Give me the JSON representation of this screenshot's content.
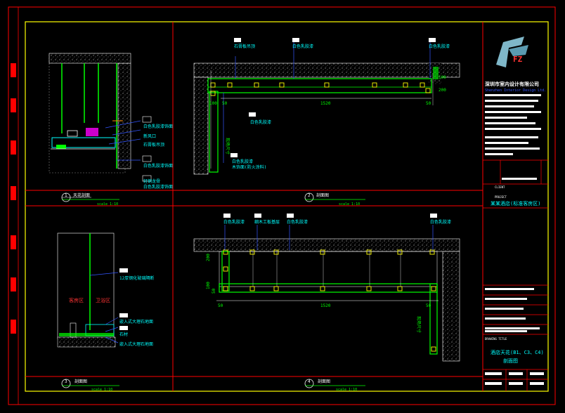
{
  "drawing": {
    "scale_text": "scale 1:10",
    "panels": [
      {
        "num": "1",
        "title": "天花剖面",
        "scale": "scale 1:10"
      },
      {
        "num": "2",
        "title": "剖面图",
        "scale": "scale 1:10"
      },
      {
        "num": "3",
        "title": "剖面图",
        "scale": "scale 1:10"
      },
      {
        "num": "4",
        "title": "剖面图",
        "scale": "scale 1:10"
      }
    ],
    "section2_notes": [
      "石膏板吊顶",
      "白色乳胶漆",
      "白色乳胶漆",
      "白色乳胶漆",
      "白色乳胶漆",
      "木饰面(防火涂料)"
    ],
    "section2_dims": [
      "100",
      "50",
      "1520",
      "50",
      "100",
      "200"
    ],
    "section2_side_text": "现场尺寸",
    "section4_notes": [
      "白色乳胶漆",
      "细木工板基层",
      "白色乳胶漆",
      "白色乳胶漆"
    ],
    "section4_dims": [
      "200",
      "100",
      "50",
      "50",
      "1520",
      "50"
    ],
    "section4_side_text": "现场尺寸",
    "section1_notes": [
      "白色乳胶漆饰面",
      "新风口",
      "石膏板吊顶",
      "白色乳胶漆饰面",
      "轻钢龙骨",
      "白色乳胶漆饰面"
    ],
    "section3_notes": [
      "12厚钢化玻璃隔断",
      "嵌入式大理石地面",
      "石材",
      "嵌入式大理石地面"
    ],
    "section3_labels": [
      "客房区",
      "卫浴区"
    ]
  },
  "title_block": {
    "firm": "深圳市室内设计有限公司",
    "firm_sub": "Shenzhen Interior Design Ltd.",
    "project_label": "PROJECT",
    "project": "某某酒店(标准客房区)",
    "client_label": "CLIENT",
    "drawing_title_label": "DRAWING TITLE",
    "drawing_title": "酒店天花(B1、C3、C4)",
    "drawing_subtitle": "剖面图",
    "logo_text": "FZ"
  },
  "colors": {
    "background": "#000000",
    "frame": "#ffff00",
    "border": "#ff0000",
    "green": "#00ff00",
    "cyan": "#00ffff",
    "white": "#ffffff",
    "blue": "#3355ff",
    "magenta": "#ff00ff"
  }
}
